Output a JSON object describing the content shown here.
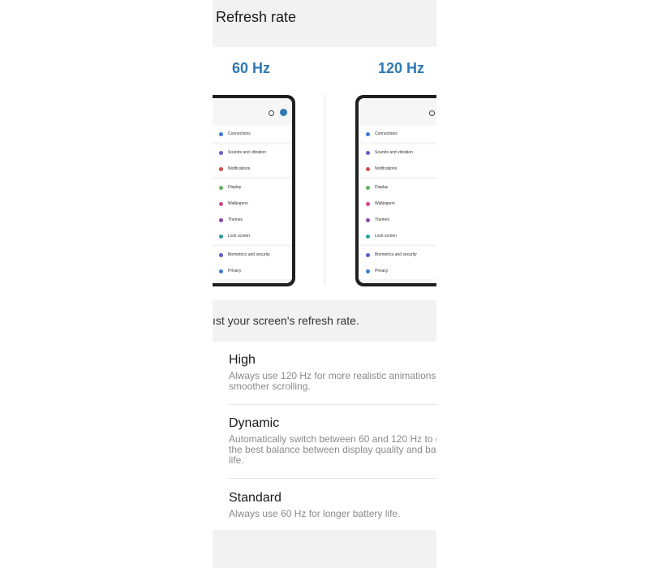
{
  "page": {
    "title": "Refresh rate"
  },
  "preview": {
    "left_label": "60 Hz",
    "right_label": "120 Hz",
    "menu_groups": [
      [
        {
          "label": "Connections",
          "color": "#3b7bd6"
        }
      ],
      [
        {
          "label": "Sounds and vibration",
          "color": "#6a5acd"
        },
        {
          "label": "Notifications",
          "color": "#d24b4b"
        }
      ],
      [
        {
          "label": "Display",
          "color": "#5bb85b"
        },
        {
          "label": "Wallpapers",
          "color": "#d6458a"
        },
        {
          "label": "Themes",
          "color": "#8e44ad"
        },
        {
          "label": "Lock screen",
          "color": "#2aa198"
        }
      ],
      [
        {
          "label": "Biometrics and security",
          "color": "#5a5acd"
        },
        {
          "label": "Privacy",
          "color": "#3b7bd6"
        }
      ]
    ]
  },
  "description": "ıst your screen's refresh rate.",
  "options": [
    {
      "title": "High",
      "desc": "Always use 120 Hz for more realistic animations\nsmoother scrolling."
    },
    {
      "title": "Dynamic",
      "desc": "Automatically switch between 60 and 120 Hz to g\nthe best balance between display quality and batt\nlife."
    },
    {
      "title": "Standard",
      "desc": "Always use 60 Hz for longer battery life."
    }
  ]
}
